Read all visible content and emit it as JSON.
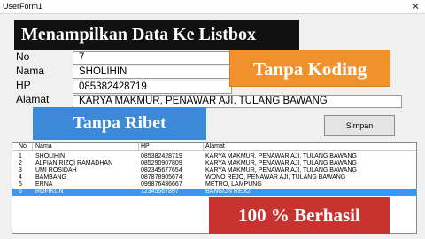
{
  "window": {
    "title": "UserForm1",
    "close_glyph": "✕"
  },
  "banner": {
    "text": "Menampilkan Data Ke Listbox"
  },
  "form": {
    "no_label": "No",
    "no_value": "7",
    "nama_label": "Nama",
    "nama_value": "SHOLIHIN",
    "hp_label": "HP",
    "hp_value": "085382428719",
    "alamat_label": "Alamat",
    "alamat_value": "KARYA MAKMUR, PENAWAR AJI, TULANG BAWANG"
  },
  "badges": {
    "koding": "Tanpa Koding",
    "ribet": "Tanpa Ribet",
    "berhasil": "100 % Berhasil"
  },
  "save_button": {
    "label": "Simpan"
  },
  "listbox": {
    "columns": {
      "no": "No",
      "nama": "Nama",
      "hp": "HP",
      "alamat": "Alamat"
    },
    "rows": [
      {
        "no": "1",
        "nama": "SHOLIHIN",
        "hp": "085382428719",
        "alamat": "KARYA MAKMUR, PENAWAR AJI, TULANG BAWANG"
      },
      {
        "no": "2",
        "nama": "ALFIAN RIZQI RAMADHAN",
        "hp": "085290907809",
        "alamat": "KARYA MAKMUR, PENAWAR AJI, TULANG BAWANG"
      },
      {
        "no": "3",
        "nama": "UMI ROSIDAH",
        "hp": "082345677654",
        "alamat": "KARYA MAKMUR, PENAWAR AJI, TULANG BAWANG"
      },
      {
        "no": "4",
        "nama": "BAMBANG",
        "hp": "087878905674",
        "alamat": "WONO REJO, PENAWAR AJI, TULANG BAWANG"
      },
      {
        "no": "5",
        "nama": "ERNA",
        "hp": "099876436667",
        "alamat": "METRO, LAMPUNG"
      },
      {
        "no": "6",
        "nama": "ROFIKUN",
        "hp": "12345567897",
        "alamat": "BANGUN REJO"
      }
    ],
    "selected_row": "6"
  }
}
